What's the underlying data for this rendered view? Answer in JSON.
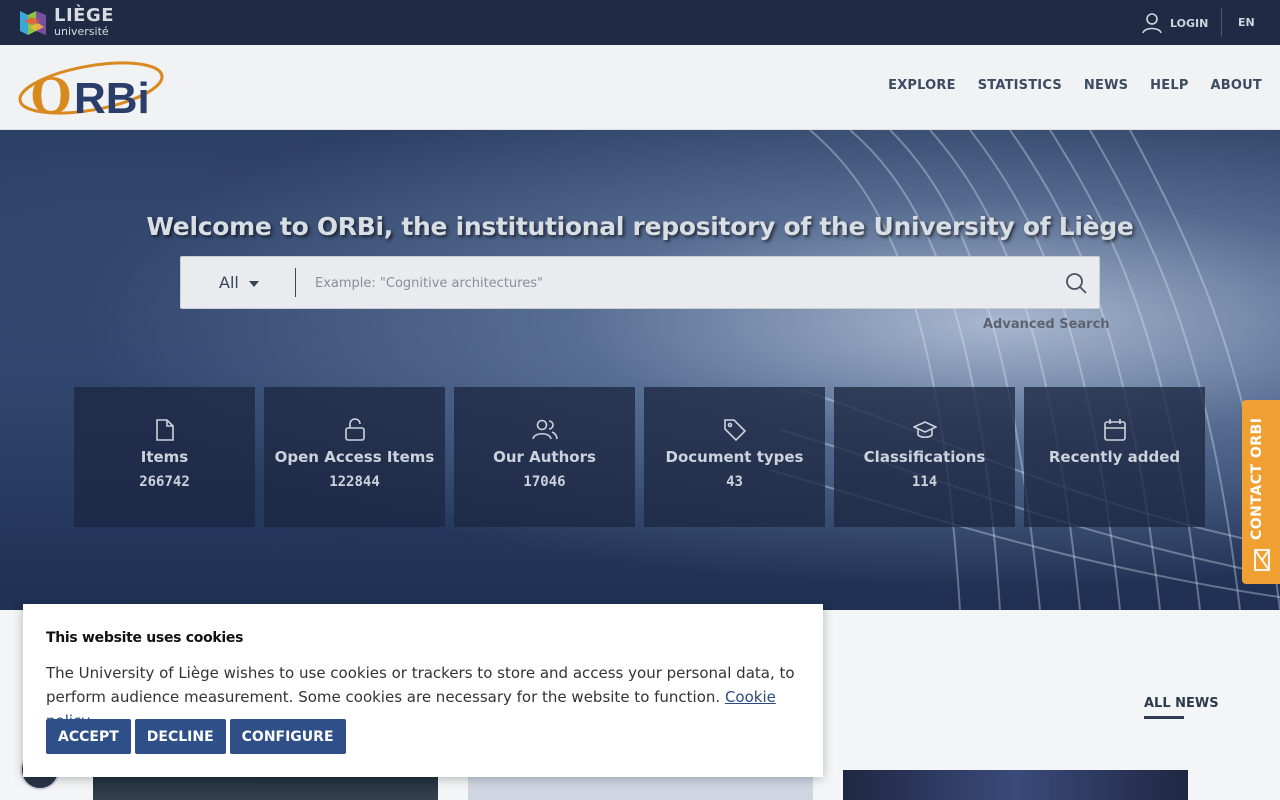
{
  "topbar": {
    "university_logo_line1": "LIÈGE",
    "university_logo_line2": "université",
    "login_label": "LOGIN",
    "language": "EN"
  },
  "header": {
    "logo_text": "ORBi",
    "nav": [
      "EXPLORE",
      "STATISTICS",
      "NEWS",
      "HELP",
      "ABOUT"
    ]
  },
  "hero": {
    "title": "Welcome to ORBi, the institutional repository of the University of Liège",
    "search": {
      "scope": "All",
      "placeholder": "Example: \"Cognitive architectures\""
    },
    "advanced_search": "Advanced Search",
    "stats": [
      {
        "icon": "document-icon",
        "label": "Items",
        "value": "266742"
      },
      {
        "icon": "unlock-icon",
        "label": "Open Access Items",
        "value": "122844"
      },
      {
        "icon": "users-icon",
        "label": "Our Authors",
        "value": "17046"
      },
      {
        "icon": "tag-icon",
        "label": "Document types",
        "value": "43"
      },
      {
        "icon": "graduation-cap-icon",
        "label": "Classifications",
        "value": "114"
      },
      {
        "icon": "calendar-icon",
        "label": "Recently added",
        "value": ""
      }
    ]
  },
  "contact": {
    "label": "CONTACT ORBI",
    "icon": "mail-icon"
  },
  "news": {
    "all_news": "ALL NEWS"
  },
  "cookie": {
    "title": "This website uses cookies",
    "text": "The University of Liège wishes to use cookies or trackers to store and access your personal data, to perform audience measurement. Some cookies are necessary for the website to function. ",
    "policy_link": "Cookie policy",
    "text_end": ".",
    "accept": "ACCEPT",
    "decline": "DECLINE",
    "configure": "CONFIGURE"
  },
  "colors": {
    "topbar": "#1f2a44",
    "accent_orange": "#f0a033",
    "button_blue": "#2e4f87"
  }
}
